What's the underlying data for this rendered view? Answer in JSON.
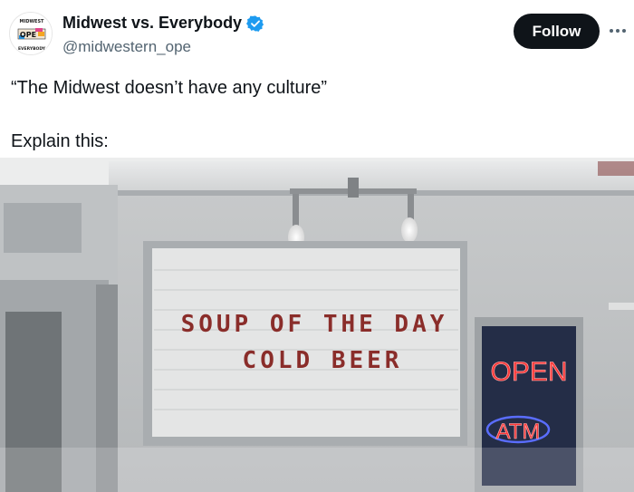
{
  "author": {
    "display_name": "Midwest vs. Everybody",
    "handle": "@midwestern_ope",
    "avatar_text": "OPE",
    "avatar_ring_top": "MIDWEST",
    "avatar_ring_bottom": "EVERYBODY",
    "verified": true
  },
  "actions": {
    "follow_label": "Follow",
    "more_icon": "more-horizontal-icon"
  },
  "post": {
    "line1": "“The Midwest doesn’t have any culture”",
    "line2": "Explain this:"
  },
  "photo": {
    "sign_line1": "SOUP OF THE DAY",
    "sign_line2": "COLD BEER",
    "neon_open": "OPEN",
    "neon_atm": "ATM"
  },
  "colors": {
    "text": "#0f1419",
    "secondary": "#536471",
    "verified": "#1d9bf0",
    "button": "#0f1419"
  }
}
